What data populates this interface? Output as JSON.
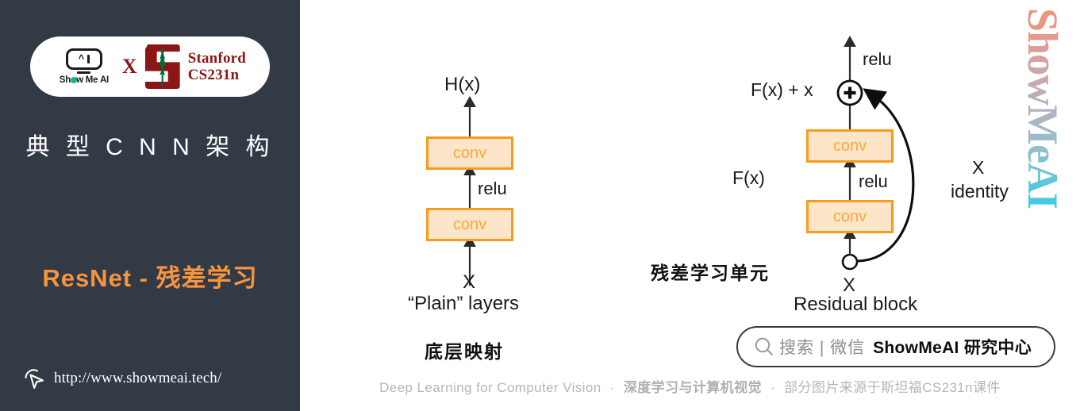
{
  "sidebar": {
    "badge": {
      "showmeai_word": "Show Me AI",
      "cross": "X",
      "stanford_line1": "Stanford",
      "stanford_line2": "CS231n"
    },
    "title": "典 型 C N N 架 构",
    "subtitle": "ResNet - 残差学习",
    "url": "http://www.showmeai.tech/",
    "bg_color": "#323a46",
    "accent_color": "#f7943e"
  },
  "main": {
    "watermark": "ShowMeAI",
    "plain_diagram": {
      "output_label": "H(x)",
      "top_box": "conv",
      "relu_label": "relu",
      "bottom_box": "conv",
      "input_label": "X",
      "caption": "“Plain” layers",
      "cn_caption": "底层映射"
    },
    "residual_diagram": {
      "top_relu_label": "relu",
      "sum_label": "F(x) + x",
      "plus_symbol": "+",
      "top_box": "conv",
      "fx_label": "F(x)",
      "relu_label": "relu",
      "bottom_box": "conv",
      "input_label": "X",
      "caption": "Residual block",
      "identity_line1": "X",
      "identity_line2": "identity",
      "cn_caption": "残差学习单元"
    },
    "box_fill": "#fde5c9",
    "box_border": "#f79b18",
    "box_text_color": "#f7a93b"
  },
  "search_pill": {
    "placeholder": "搜索 | 微信",
    "brand": "ShowMeAI 研究中心"
  },
  "footer": {
    "part1": "Deep Learning for Computer Vision",
    "sep1": "·",
    "part2": "深度学习与计算机视觉",
    "sep2": "·",
    "part3": "部分图片来源于斯坦福CS231n课件"
  }
}
